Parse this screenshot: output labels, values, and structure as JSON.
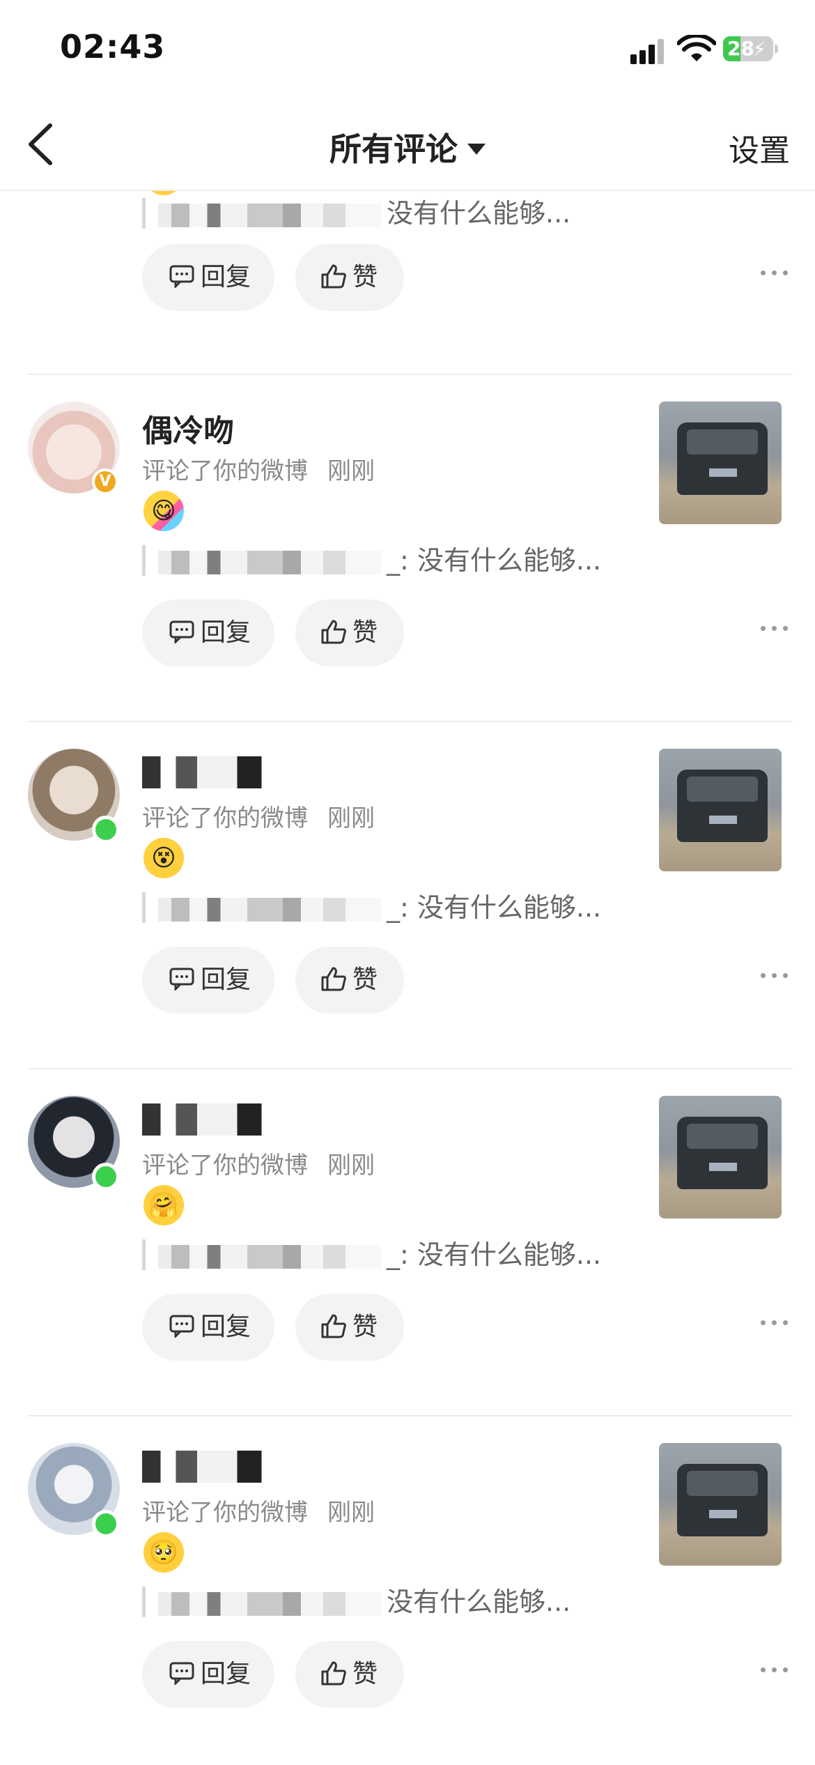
{
  "status_bar": {
    "time": "02:43",
    "battery": "28"
  },
  "nav": {
    "title": "所有评论",
    "settings_label": "设置"
  },
  "top_partial": {
    "quote_text": "没有什么能够...",
    "reply_label": "回复",
    "like_label": "赞"
  },
  "comments": [
    {
      "username": "偶冷吻",
      "action": "评论了你的微博",
      "time_ago": "刚刚",
      "quote_suffix": "_: 没有什么能够...",
      "reply_label": "回复",
      "like_label": "赞",
      "badge": "V",
      "avatar_color": "#f3ddd6"
    },
    {
      "username": "",
      "action": "评论了你的微博",
      "time_ago": "刚刚",
      "quote_suffix": "_: 没有什么能够...",
      "reply_label": "回复",
      "like_label": "赞",
      "avatar_color": "#c9b6a4"
    },
    {
      "username": "",
      "action": "评论了你的微博",
      "time_ago": "刚刚",
      "quote_suffix": "_: 没有什么能够...",
      "reply_label": "回复",
      "like_label": "赞",
      "avatar_color": "#3f4655"
    },
    {
      "username": "",
      "action": "评论了你的微博",
      "time_ago": "刚刚",
      "quote_suffix": "没有什么能够...",
      "reply_label": "回复",
      "like_label": "赞",
      "avatar_color": "#b9c7d8"
    }
  ],
  "colors": {
    "online": "#3ccf4e",
    "verified": "#f0a91e",
    "text_secondary": "#8a8a8a"
  },
  "icons": [
    "chevron-left-icon",
    "caret-down-icon",
    "comment-icon",
    "thumbs-up-icon",
    "more-icon",
    "wifi-icon",
    "signal-icon",
    "battery-icon"
  ]
}
